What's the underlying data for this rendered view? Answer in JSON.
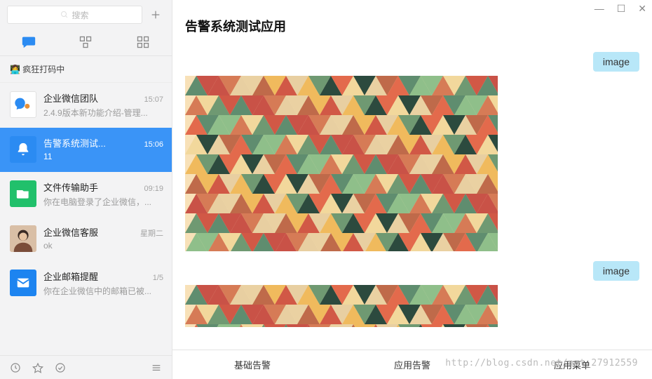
{
  "search": {
    "placeholder": "搜索"
  },
  "status": {
    "emoji": "👩‍💻",
    "text": "疯狂打码中"
  },
  "chats": [
    {
      "title": "企业微信团队",
      "time": "15:07",
      "sub": "2.4.9版本新功能介绍-管理...",
      "avatar": "wecom",
      "active": false
    },
    {
      "title": "告警系统测试...",
      "time": "15:06",
      "sub": "11",
      "avatar": "bell",
      "active": true
    },
    {
      "title": "文件传输助手",
      "time": "09:19",
      "sub": "你在电脑登录了企业微信，...",
      "avatar": "file",
      "active": false
    },
    {
      "title": "企业微信客服",
      "time": "星期二",
      "sub": "ok",
      "avatar": "person",
      "active": false
    },
    {
      "title": "企业邮箱提醒",
      "time": "1/5",
      "sub": "你在企业微信中的邮箱已被...",
      "avatar": "mail",
      "active": false
    }
  ],
  "main": {
    "title": "告警系统测试应用",
    "image_label": "image",
    "tabs": [
      {
        "label": "基础告警"
      },
      {
        "label": "应用告警"
      },
      {
        "label": "应用菜单"
      }
    ]
  },
  "watermark": "http://blog.csdn.net/nat_27912559",
  "window": {
    "min": "—",
    "max": "☐",
    "close": "✕"
  },
  "triangle_colors": [
    "#5f8d6f",
    "#e36a4c",
    "#f0ba5d",
    "#c95247",
    "#8fbf8a",
    "#2c4a3e",
    "#e8cfa1",
    "#d67b56",
    "#f2d89c",
    "#bf6a4a",
    "#6f9972",
    "#ead1a2",
    "#d15846"
  ]
}
